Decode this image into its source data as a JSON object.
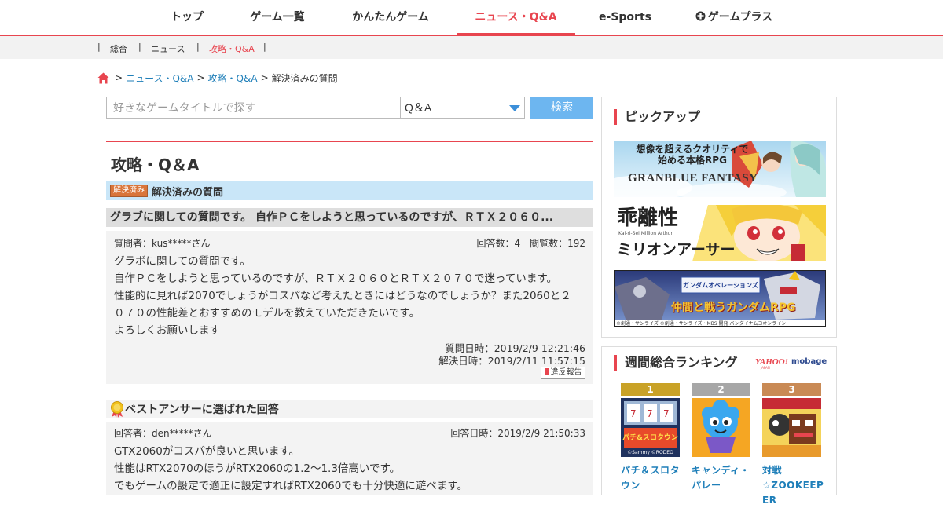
{
  "topnav": {
    "items": [
      "トップ",
      "ゲーム一覧",
      "かんたんゲーム",
      "ニュース・Q&A",
      "e-Sports",
      "ゲームプラス"
    ]
  },
  "subnav": {
    "items": [
      "総合",
      "ニュース",
      "攻略・Q&A"
    ],
    "separator": "|"
  },
  "breadcrumb": {
    "items": [
      "ニュース・Q&A",
      "攻略・Q&A",
      "解決済みの質問"
    ],
    "separator": ">"
  },
  "search": {
    "placeholder": "好きなゲームタイトルで探す",
    "category": "Q＆A",
    "button_label": "検索"
  },
  "main": {
    "title": "攻略・Q＆A",
    "status_badge": "解決済み",
    "status_label": "解決済みの質問",
    "question_title": "グラブに関しての質問です。 自作ＰＣをしようと思っているのですが、ＲＴＸ２０６０...",
    "question": {
      "asker": "質問者：kus*****さん",
      "stats": "回答数：4　閲覧数：192",
      "body": [
        "グラボに関しての質問です。",
        "自作ＰＣをしようと思っているのですが、ＲＴＸ２０６０とＲＴＸ２０７０で迷っています。",
        "性能的に見れば2070でしょうがコスパなど考えたときにはどうなのでしょうか？また2060と２",
        "０７０の性能差とおすすめのモデルを教えていただきたいです。",
        "よろしくお願いします"
      ],
      "asked_at": "質問日時：2019/2/9 12:21:46",
      "resolved_at": "解決日時：2019/2/11 11:57:15",
      "report_label": "違反報告"
    },
    "best_answer_label": "ベストアンサーに選ばれた回答",
    "answer": {
      "answerer": "回答者：den*****さん",
      "answered_at": "回答日時：2019/2/9 21:50:33",
      "body": [
        "GTX2060がコスパが良いと思います。",
        "性能はRTX2070のほうがRTX2060の1.2～1.3倍高いです。",
        "でもゲームの設定で適正に設定すればRTX2060でも十分快適に遊べます。"
      ]
    }
  },
  "sidebar": {
    "pickup_title": "ピックアップ",
    "banners": [
      {
        "lines": [
          "想像を超えるクオリティで",
          "始める本格RPG"
        ],
        "logo": "GRANBLUE FANTASY"
      },
      {
        "title": "乖離性",
        "subtitle": "ミリオンアーサー",
        "small": "Kai-ri-Sei Million Arthur"
      },
      {
        "title": "ガンダムオペレーションズ",
        "tagline": "仲間と戦うガンダムRPG",
        "footer": "©創通・サンライズ ©創通・サンライズ・MBS 開発 バンダイナムコオンライン"
      }
    ],
    "ranking_title": "週間総合ランキング",
    "ranking_logo": {
      "yahoo": "YAHOO!",
      "mobage": "mobage",
      "japan": "JAPAN"
    },
    "ranking": [
      {
        "rank": "1",
        "name_lines": [
          "パチ＆スロタ",
          "ウン"
        ],
        "color": "#c9a227",
        "art_label": "パチ&スロタウン",
        "art_small": "©Sammy ©RODEO"
      },
      {
        "rank": "2",
        "name_lines": [
          "キャンディ・",
          "パレー"
        ],
        "color": "#a7a7a7"
      },
      {
        "rank": "3",
        "name_lines": [
          "対戦",
          "☆ZOOKEEP",
          "ER"
        ],
        "color": "#c98a55"
      }
    ]
  },
  "colors": {
    "accent": "#e8454f",
    "link": "#1f7fb9",
    "search_button": "#6db6f0",
    "status_bar": "#c9e6f8"
  }
}
